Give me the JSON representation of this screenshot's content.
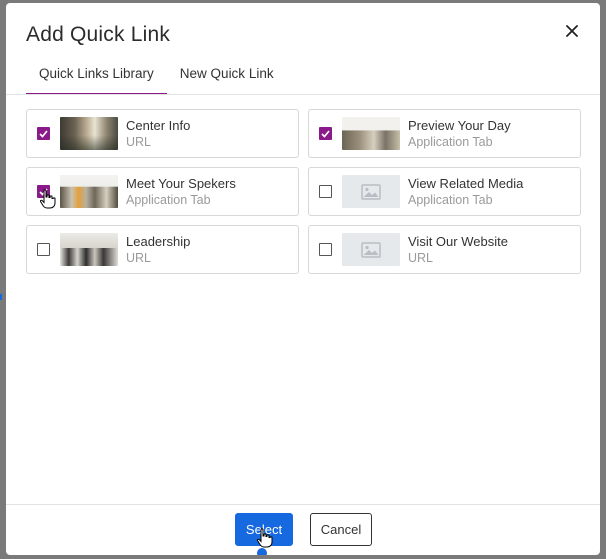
{
  "dialog": {
    "title": "Add Quick Link",
    "close_icon": "close-icon"
  },
  "tabs": [
    {
      "label": "Quick Links Library",
      "active": true
    },
    {
      "label": "New Quick Link",
      "active": false
    }
  ],
  "items": [
    {
      "title": "Center Info",
      "subtitle": "URL",
      "checked": true,
      "thumbnail": "photo"
    },
    {
      "title": "Preview Your Day",
      "subtitle": "Application Tab",
      "checked": true,
      "thumbnail": "photo"
    },
    {
      "title": "Meet Your Spekers",
      "subtitle": "Application Tab",
      "checked": true,
      "thumbnail": "photo"
    },
    {
      "title": "View Related Media",
      "subtitle": "Application Tab",
      "checked": false,
      "thumbnail": "image-placeholder-icon"
    },
    {
      "title": "Leadership",
      "subtitle": "URL",
      "checked": false,
      "thumbnail": "photo"
    },
    {
      "title": "Visit Our Website",
      "subtitle": "URL",
      "checked": false,
      "thumbnail": "image-placeholder-icon"
    }
  ],
  "footer": {
    "select_label": "Select",
    "cancel_label": "Cancel"
  },
  "colors": {
    "accent": "#8a1a8a",
    "primary_button": "#1769e0",
    "overlay": "#7a7a7a"
  }
}
